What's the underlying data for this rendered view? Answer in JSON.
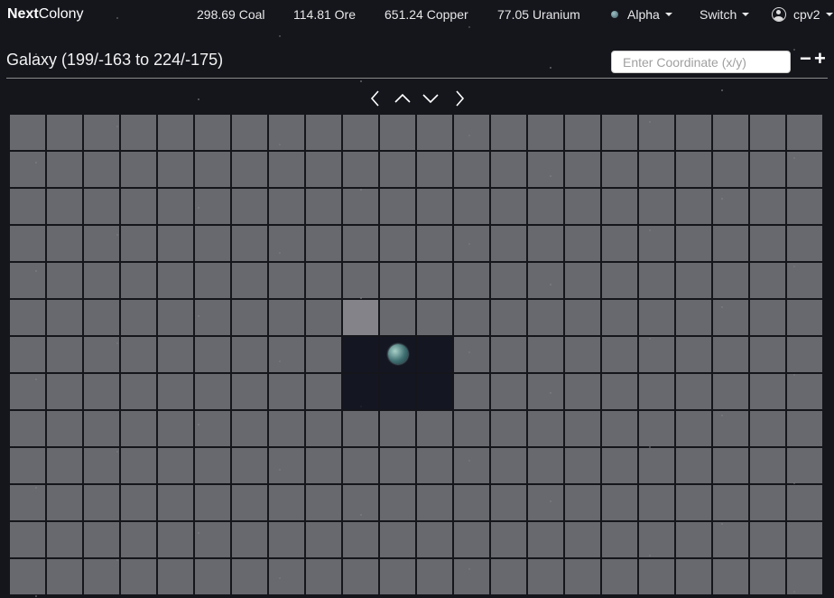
{
  "app": {
    "brand_bold": "Next",
    "brand_rest": "Colony"
  },
  "resources": [
    {
      "value": "298.69",
      "name": "Coal"
    },
    {
      "value": "114.81",
      "name": "Ore"
    },
    {
      "value": "651.24",
      "name": "Copper"
    },
    {
      "value": "77.05",
      "name": "Uranium"
    }
  ],
  "menus": {
    "planet": "Alpha",
    "switch": "Switch",
    "user": "cpv2"
  },
  "galaxy": {
    "title": "Galaxy (199/-163 to 224/-175)"
  },
  "coordinate": {
    "placeholder": "Enter Coordinate (x/y)",
    "value": ""
  },
  "zoom": {
    "out": "−",
    "in": "+"
  },
  "nav_icons": [
    "chevron-left-icon",
    "chevron-up-icon",
    "chevron-down-icon",
    "chevron-right-icon"
  ],
  "map": {
    "columns": 22,
    "rows": 13,
    "highlighted_cells": [
      {
        "row": 5,
        "col": 9
      }
    ],
    "explored_cells": [
      {
        "row": 6,
        "col": 9
      },
      {
        "row": 6,
        "col": 10
      },
      {
        "row": 6,
        "col": 11
      },
      {
        "row": 7,
        "col": 9
      },
      {
        "row": 7,
        "col": 10
      },
      {
        "row": 7,
        "col": 11
      }
    ],
    "planet_cell": {
      "row": 6,
      "col": 10
    }
  },
  "colors": {
    "background": "#15161c",
    "cell": "#808086",
    "explored": "#141622"
  }
}
